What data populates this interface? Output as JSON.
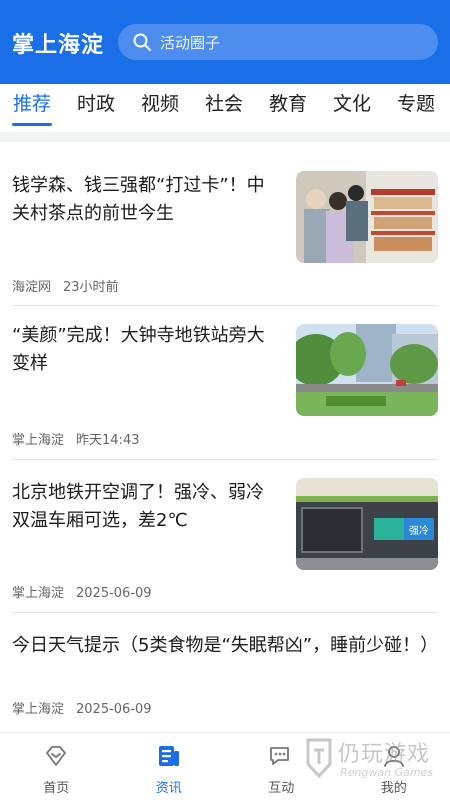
{
  "header": {
    "app_title": "掌上海淀",
    "search_placeholder": "活动圈子"
  },
  "tabs": [
    {
      "label": "推荐",
      "active": true
    },
    {
      "label": "时政",
      "active": false
    },
    {
      "label": "视频",
      "active": false
    },
    {
      "label": "社会",
      "active": false
    },
    {
      "label": "教育",
      "active": false
    },
    {
      "label": "文化",
      "active": false
    },
    {
      "label": "专题",
      "active": false
    }
  ],
  "news": [
    {
      "title": "钱学森、钱三强都“打过卡”！中关村茶点的前世今生",
      "source": "海淀网",
      "time": "23小时前",
      "thumb": "shop-counter-photo"
    },
    {
      "title": "“美颜”完成！大钟寺地铁站旁大变样",
      "source": "掌上海淀",
      "time": "昨天14:43",
      "thumb": "street-greenery-photo"
    },
    {
      "title": "北京地铁开空调了！强冷、弱冷双温车厢可选，差2℃",
      "source": "掌上海淀",
      "time": "2025-06-09",
      "thumb": "subway-car-photo",
      "thumb_sign": "强冷"
    },
    {
      "title": "今日天气提示（5类食物是“失眠帮凶”，睡前少碰！）",
      "source": "掌上海淀",
      "time": "2025-06-09"
    }
  ],
  "bottom_nav": [
    {
      "label": "首页",
      "icon": "home-diamond-icon",
      "active": false
    },
    {
      "label": "资讯",
      "icon": "news-icon",
      "active": true
    },
    {
      "label": "互动",
      "icon": "chat-icon",
      "active": false
    },
    {
      "label": "我的",
      "icon": "profile-icon",
      "active": false
    }
  ],
  "watermark": {
    "text": "仍玩游戏",
    "sub": "Rengwan Games"
  },
  "colors": {
    "brand": "#1a6ee8",
    "divider": "#e6e6e6"
  }
}
